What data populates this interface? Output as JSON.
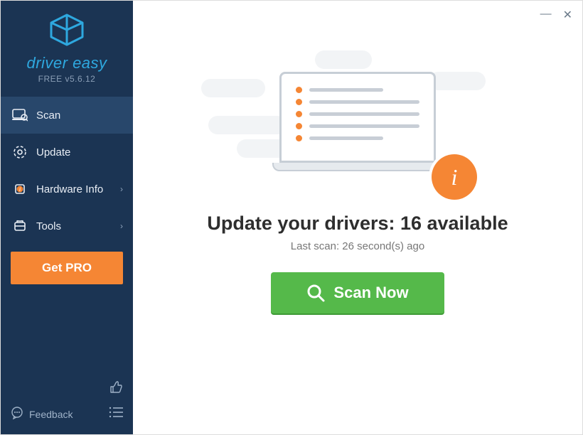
{
  "brand": {
    "name": "driver easy",
    "version": "FREE v5.6.12"
  },
  "nav": {
    "scan": "Scan",
    "update": "Update",
    "hardware": "Hardware Info",
    "tools": "Tools"
  },
  "get_pro": "Get PRO",
  "feedback": "Feedback",
  "main": {
    "headline": "Update your drivers: 16 available",
    "subline": "Last scan: 26 second(s) ago",
    "scan_button": "Scan Now"
  },
  "window": {
    "minimize": "—",
    "close": "✕"
  }
}
